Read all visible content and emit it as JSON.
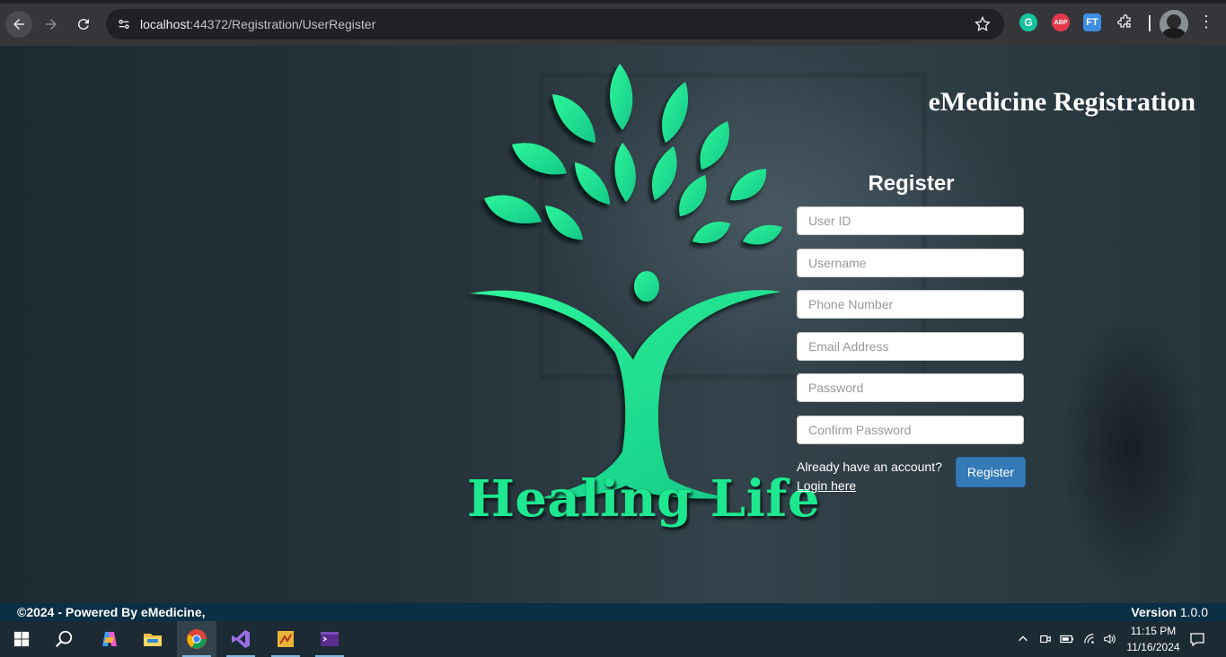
{
  "browser": {
    "url_host": "localhost",
    "url_path": ":44372/Registration/UserRegister",
    "extensions": {
      "grammarly": "G",
      "adblock": "ABP",
      "ft": "FT"
    }
  },
  "page": {
    "heading": "eMedicine Registration",
    "brand_text": "Healing Life",
    "brand_color": "#1ee88f",
    "form": {
      "title": "Register",
      "fields": {
        "user_id": "User ID",
        "username": "Username",
        "phone": "Phone Number",
        "email": "Email Address",
        "password": "Password",
        "confirm_password": "Confirm Password"
      },
      "already_text": "Already have an account?",
      "login_link": "Login here",
      "submit_label": "Register",
      "submit_color": "#337ab7"
    }
  },
  "footer": {
    "copyright": "©2024 - Powered By eMedicine,",
    "version_label": "Version",
    "version_number": "1.0.0"
  },
  "taskbar": {
    "apps": [
      "start-icon",
      "search-icon",
      "copilot-icon",
      "file-explorer-icon",
      "chrome-icon",
      "visual-studio-icon",
      "sql-tool-icon",
      "terminal-icon"
    ],
    "time": "11:15 PM",
    "date": "11/16/2024"
  }
}
